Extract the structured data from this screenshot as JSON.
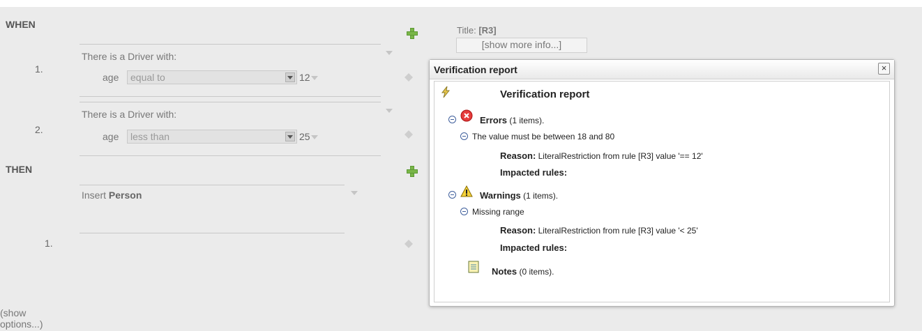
{
  "rule": {
    "when_label": "WHEN",
    "then_label": "THEN",
    "conditions": [
      {
        "index": "1.",
        "pattern": "There is a Driver with:",
        "field": "age",
        "operator": "equal to",
        "value": "12"
      },
      {
        "index": "2.",
        "pattern": "There is a Driver with:",
        "field": "age",
        "operator": "less than",
        "value": "25"
      }
    ],
    "action": {
      "prefix": "Insert ",
      "fact": "Person"
    },
    "action_index": "1.",
    "show_options_1": "(show",
    "show_options_2": "options...)",
    "title_prefix": "Title: ",
    "title_value": "[R3]",
    "show_more_info": "[show more info...]"
  },
  "dialog": {
    "window_title": "Verification report",
    "close": "×",
    "heading": "Verification report",
    "errors": {
      "label": "Errors",
      "count": "(1 items)."
    },
    "error_item": {
      "message": "The value must be between 18 and 80",
      "reason_label": "Reason:",
      "reason_text": " LiteralRestriction from rule [R3] value '== 12'",
      "impacted": "Impacted rules:"
    },
    "warnings": {
      "label": "Warnings",
      "count": "(1 items)."
    },
    "warning_item": {
      "message": "Missing range",
      "reason_label": "Reason:",
      "reason_text": " LiteralRestriction from rule [R3] value '< 25'",
      "impacted": "Impacted rules:"
    },
    "notes": {
      "label": "Notes",
      "count": "(0 items)."
    }
  },
  "icons": {
    "add": "add-icon",
    "report": "report-icon",
    "error": "error-icon",
    "warning": "warning-icon",
    "notes": "notes-icon"
  }
}
